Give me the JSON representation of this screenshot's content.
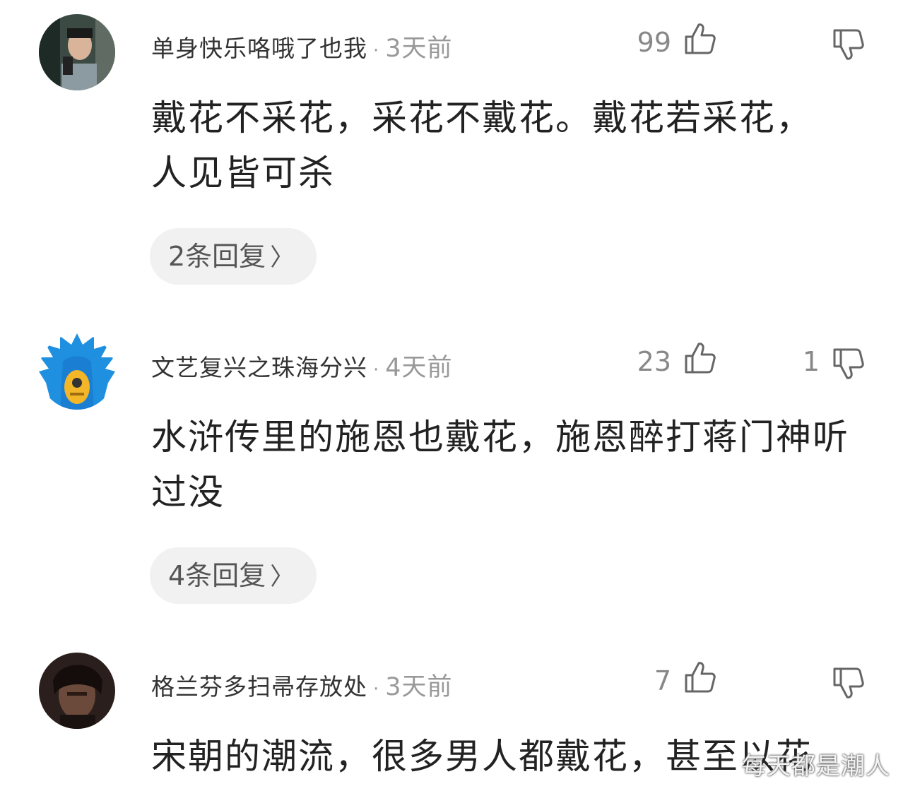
{
  "comments": [
    {
      "username": "单身快乐咯哦了也我",
      "separator": "·",
      "time": "3天前",
      "likes": "99",
      "dislikes": "",
      "text": "戴花不采花，采花不戴花。戴花若采花，人见皆可杀",
      "replies_label": "2条回复",
      "chevron": "〉",
      "avatar_icon": "avatar-photo-man-selfie"
    },
    {
      "username": "文艺复兴之珠海分兴",
      "separator": "·",
      "time": "4天前",
      "likes": "23",
      "dislikes": "1",
      "text": "水浒传里的施恩也戴花，施恩醉打蒋门神听过没",
      "replies_label": "4条回复",
      "chevron": "〉",
      "avatar_icon": "avatar-anime-blue-hair"
    },
    {
      "username": "格兰芬多扫帚存放处",
      "separator": "·",
      "time": "3天前",
      "likes": "7",
      "dislikes": "",
      "text": "宋朝的潮流，很多男人都戴花，甚至以花",
      "avatar_icon": "avatar-dark-portrait"
    }
  ],
  "icons": {
    "like": "thumbs-up-icon",
    "dislike": "thumbs-down-icon"
  },
  "colors": {
    "text": "#222222",
    "muted": "#999999",
    "reply_bg": "#f1f1f1",
    "anime_blue": "#1f8fe0"
  },
  "watermark": "每天都是潮人"
}
